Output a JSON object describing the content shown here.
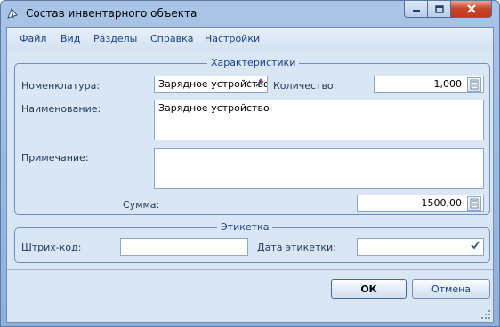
{
  "window": {
    "title": "Состав инвентарного объекта"
  },
  "menu": {
    "items": [
      {
        "label": "Файл"
      },
      {
        "label": "Вид"
      },
      {
        "label": "Разделы"
      },
      {
        "label": "Справка"
      },
      {
        "label": "Настройки"
      }
    ]
  },
  "characteristics": {
    "title": "Характеристики",
    "nomenclature_label": "Номенклатура:",
    "nomenclature_value": "Зарядное устройство",
    "quantity_label": "Количество:",
    "quantity_value": "1,000",
    "name_label": "Наименование:",
    "name_value": "Зарядное устройство",
    "note_label": "Примечание:",
    "note_value": "",
    "sum_label": "Сумма:",
    "sum_value": "1500,00"
  },
  "label_group": {
    "title": "Этикетка",
    "barcode_label": "Штрих-код:",
    "barcode_value": "",
    "label_date_label": "Дата этикетки:",
    "label_date_value": ""
  },
  "buttons": {
    "ok": "ОК",
    "cancel": "Отмена",
    "ellipsis": "···"
  }
}
